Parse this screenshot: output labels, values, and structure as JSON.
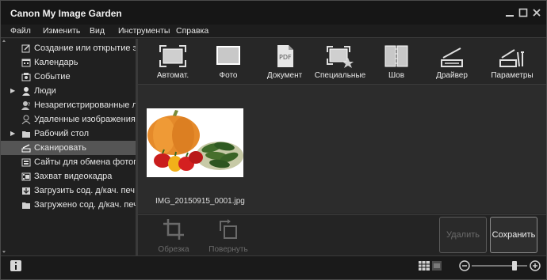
{
  "app": {
    "title": "Canon My Image Garden"
  },
  "window_controls": {
    "minimize": "minimize-icon",
    "maximize": "maximize-icon",
    "close": "close-icon"
  },
  "menu": [
    "Файл",
    "Изменить",
    "Вид",
    "Инструменты",
    "Справка"
  ],
  "sidebar": {
    "items": [
      {
        "label": "Создание или открытие эле",
        "icon": "create-open-icon",
        "expandable": false,
        "selected": false
      },
      {
        "label": "Календарь",
        "icon": "calendar-icon",
        "expandable": false,
        "selected": false
      },
      {
        "label": "Событие",
        "icon": "event-icon",
        "expandable": false,
        "selected": false
      },
      {
        "label": "Люди",
        "icon": "person-icon",
        "expandable": true,
        "selected": false
      },
      {
        "label": "Незарегистрированные люд",
        "icon": "unregistered-person-icon",
        "expandable": false,
        "selected": false
      },
      {
        "label": "Удаленные изображения лю",
        "icon": "deleted-person-icon",
        "expandable": false,
        "selected": false
      },
      {
        "label": "Рабочий стол",
        "icon": "folder-icon",
        "expandable": true,
        "selected": false
      },
      {
        "label": "Сканировать",
        "icon": "scanner-icon",
        "expandable": false,
        "selected": true
      },
      {
        "label": "Сайты для обмена фотогра",
        "icon": "photo-sharing-icon",
        "expandable": false,
        "selected": false
      },
      {
        "label": "Захват видеокадра",
        "icon": "video-frame-icon",
        "expandable": false,
        "selected": false
      },
      {
        "label": "Загрузить сод. д/кач. печ.",
        "icon": "download-icon",
        "expandable": false,
        "selected": false
      },
      {
        "label": "Загружено сод. д/кач. печ.",
        "icon": "downloaded-folder-icon",
        "expandable": false,
        "selected": false
      }
    ]
  },
  "toolbar": {
    "buttons": [
      {
        "label": "Автомат.",
        "icon": "auto-scan-icon"
      },
      {
        "label": "Фото",
        "icon": "photo-scan-icon"
      },
      {
        "label": "Документ",
        "icon": "document-pdf-icon"
      },
      {
        "label": "Специальные",
        "icon": "custom-scan-icon"
      },
      {
        "label": "Шов",
        "icon": "stitch-icon"
      },
      {
        "label": "Драйвер",
        "icon": "driver-icon"
      },
      {
        "label": "Параметры",
        "icon": "settings-scan-icon"
      }
    ]
  },
  "content": {
    "thumbnails": [
      {
        "filename": "IMG_20150915_0001.jpg"
      }
    ]
  },
  "actions": {
    "crop_label": "Обрезка",
    "rotate_label": "Повернуть",
    "delete_label": "Удалить",
    "save_label": "Сохранить"
  },
  "statusbar": {
    "info_icon": "info-icon",
    "view_icons": [
      "grid-view-icon",
      "list-view-icon"
    ],
    "zoom": {
      "minus": "zoom-out-icon",
      "plus": "zoom-in-icon",
      "level_fraction": 0.77
    }
  },
  "colors": {
    "selected_row": "#555555",
    "background": "#262626"
  }
}
